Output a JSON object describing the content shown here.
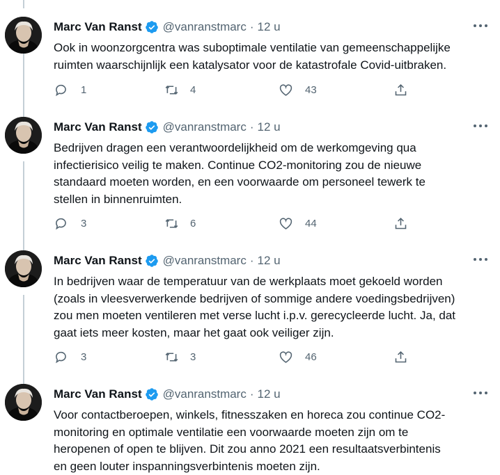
{
  "tweets": [
    {
      "name": "Marc Van Ranst",
      "handle": "@vanranstmarc",
      "time": "12 u",
      "lines": [
        "Ook in woonzorgcentra was suboptimale ventilatie van gemeenschappelijke",
        "ruimten waarschijnlijk een katalysator voor de katastrofale Covid-uitbraken."
      ],
      "replies": "1",
      "retweets": "4",
      "likes": "43"
    },
    {
      "name": "Marc Van Ranst",
      "handle": "@vanranstmarc",
      "time": "12 u",
      "lines": [
        "Bedrijven dragen een verantwoordelijkheid om de werkomgeving qua",
        "infectierisico veilig te maken. Continue CO2-monitoring zou de nieuwe",
        "standaard moeten worden, en een voorwaarde om personeel tewerk te",
        "stellen in binnenruimten."
      ],
      "replies": "3",
      "retweets": "6",
      "likes": "44"
    },
    {
      "name": "Marc Van Ranst",
      "handle": "@vanranstmarc",
      "time": "12 u",
      "lines": [
        "In bedrijven waar de temperatuur van de werkplaats moet gekoeld worden",
        "(zoals in vleesverwerkende bedrijven of sommige andere voedingsbedrijven)",
        "zou men moeten ventileren met verse lucht i.p.v. gerecycleerde lucht. Ja, dat",
        "gaat iets meer kosten, maar het gaat ook veiliger zijn."
      ],
      "replies": "3",
      "retweets": "3",
      "likes": "46"
    },
    {
      "name": "Marc Van Ranst",
      "handle": "@vanranstmarc",
      "time": "12 u",
      "lines": [
        "Voor contactberoepen, winkels, fitnesszaken en horeca zou continue CO2-",
        "monitoring en optimale ventilatie een voorwaarde moeten zijn om te",
        "heropenen of open te blijven. Dit zou anno 2021 een resultaatsverbintenis",
        "en geen louter inspanningsverbintenis moeten zijn."
      ]
    }
  ],
  "separator": "·",
  "icons": {
    "verified": "verified-badge-icon",
    "more": "more-icon",
    "reply": "reply-icon",
    "retweet": "retweet-icon",
    "like": "like-icon",
    "share": "share-icon"
  },
  "colors": {
    "text": "#0f1419",
    "secondary": "#536471",
    "verified": "#1d9bf0",
    "thread_line": "#c4cfd6"
  }
}
